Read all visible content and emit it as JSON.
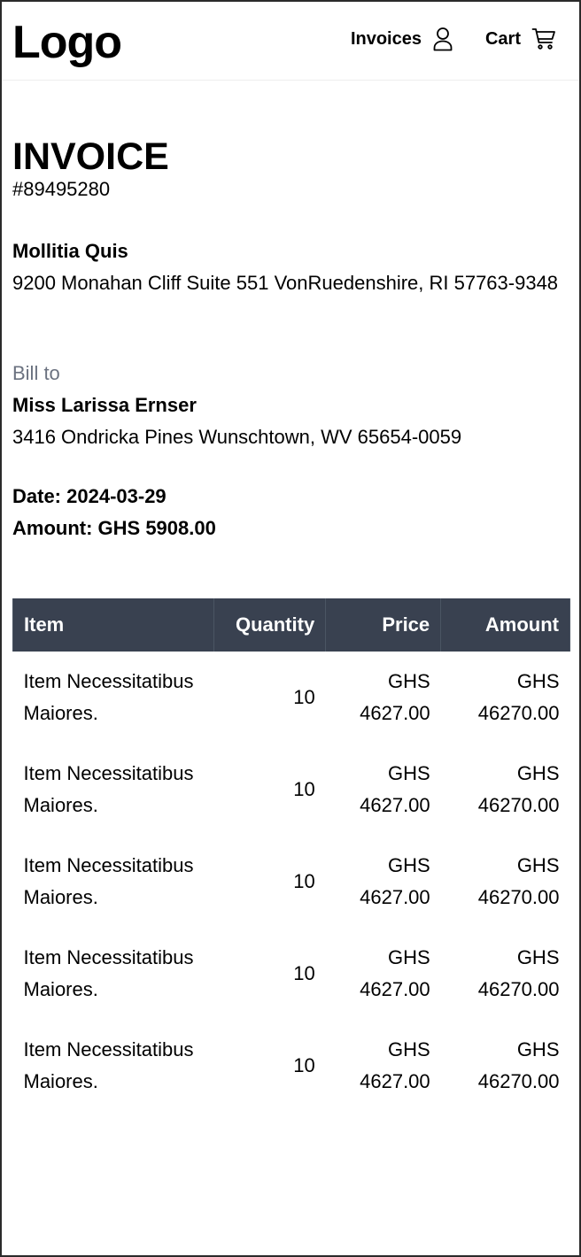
{
  "header": {
    "logo": "Logo",
    "nav": [
      {
        "label": "Invoices",
        "icon": "user-icon"
      },
      {
        "label": "Cart",
        "icon": "cart-icon"
      }
    ]
  },
  "invoice": {
    "title": "INVOICE",
    "number": "#89495280",
    "seller": {
      "name": "Mollitia Quis",
      "address": "9200 Monahan Cliff Suite 551 VonRuedenshire, RI 57763-9348"
    },
    "bill_to": {
      "label": "Bill to",
      "name": "Miss Larissa Ernser",
      "address": "3416 Ondricka Pines Wunschtown, WV 65654-0059"
    },
    "date_line": "Date: 2024-03-29",
    "amount_line": "Amount: GHS 5908.00"
  },
  "table": {
    "headers": [
      "Item",
      "Quantity",
      "Price",
      "Amount"
    ],
    "rows": [
      {
        "item": "Item Necessitatibus Maiores.",
        "quantity": "10",
        "price": "GHS 4627.00",
        "amount": "GHS 46270.00"
      },
      {
        "item": "Item Necessitatibus Maiores.",
        "quantity": "10",
        "price": "GHS 4627.00",
        "amount": "GHS 46270.00"
      },
      {
        "item": "Item Necessitatibus Maiores.",
        "quantity": "10",
        "price": "GHS 4627.00",
        "amount": "GHS 46270.00"
      },
      {
        "item": "Item Necessitatibus Maiores.",
        "quantity": "10",
        "price": "GHS 4627.00",
        "amount": "GHS 46270.00"
      },
      {
        "item": "Item Necessitatibus Maiores.",
        "quantity": "10",
        "price": "GHS 4627.00",
        "amount": "GHS 46270.00"
      }
    ]
  },
  "colors": {
    "table_header_bg": "#394150",
    "muted_text": "#6b7280"
  }
}
